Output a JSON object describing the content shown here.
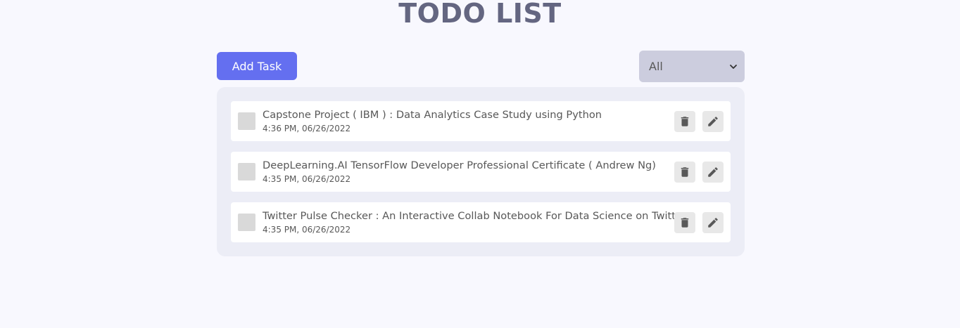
{
  "header": {
    "title": "TODO LIST"
  },
  "toolbar": {
    "add_label": "Add Task",
    "filter": {
      "selected": "All",
      "icon": "chevron-down-icon"
    }
  },
  "todos": [
    {
      "title": "Capstone Project ( IBM ) : Data Analytics Case Study using Python",
      "time": "4:36 PM, 06/26/2022"
    },
    {
      "title": "DeepLearning.AI TensorFlow Developer Professional Certificate ( Andrew Ng)",
      "time": "4:35 PM, 06/26/2022"
    },
    {
      "title": "Twitter Pulse Checker : An Interactive Collab Notebook For Data Science on Twitter",
      "time": "4:35 PM, 06/26/2022"
    }
  ],
  "colors": {
    "accent": "#646ff0",
    "title": "#646681",
    "background": "#f8f8fe",
    "list_background": "#ecedf6",
    "select_background": "#cccdde",
    "text": "#585858"
  }
}
